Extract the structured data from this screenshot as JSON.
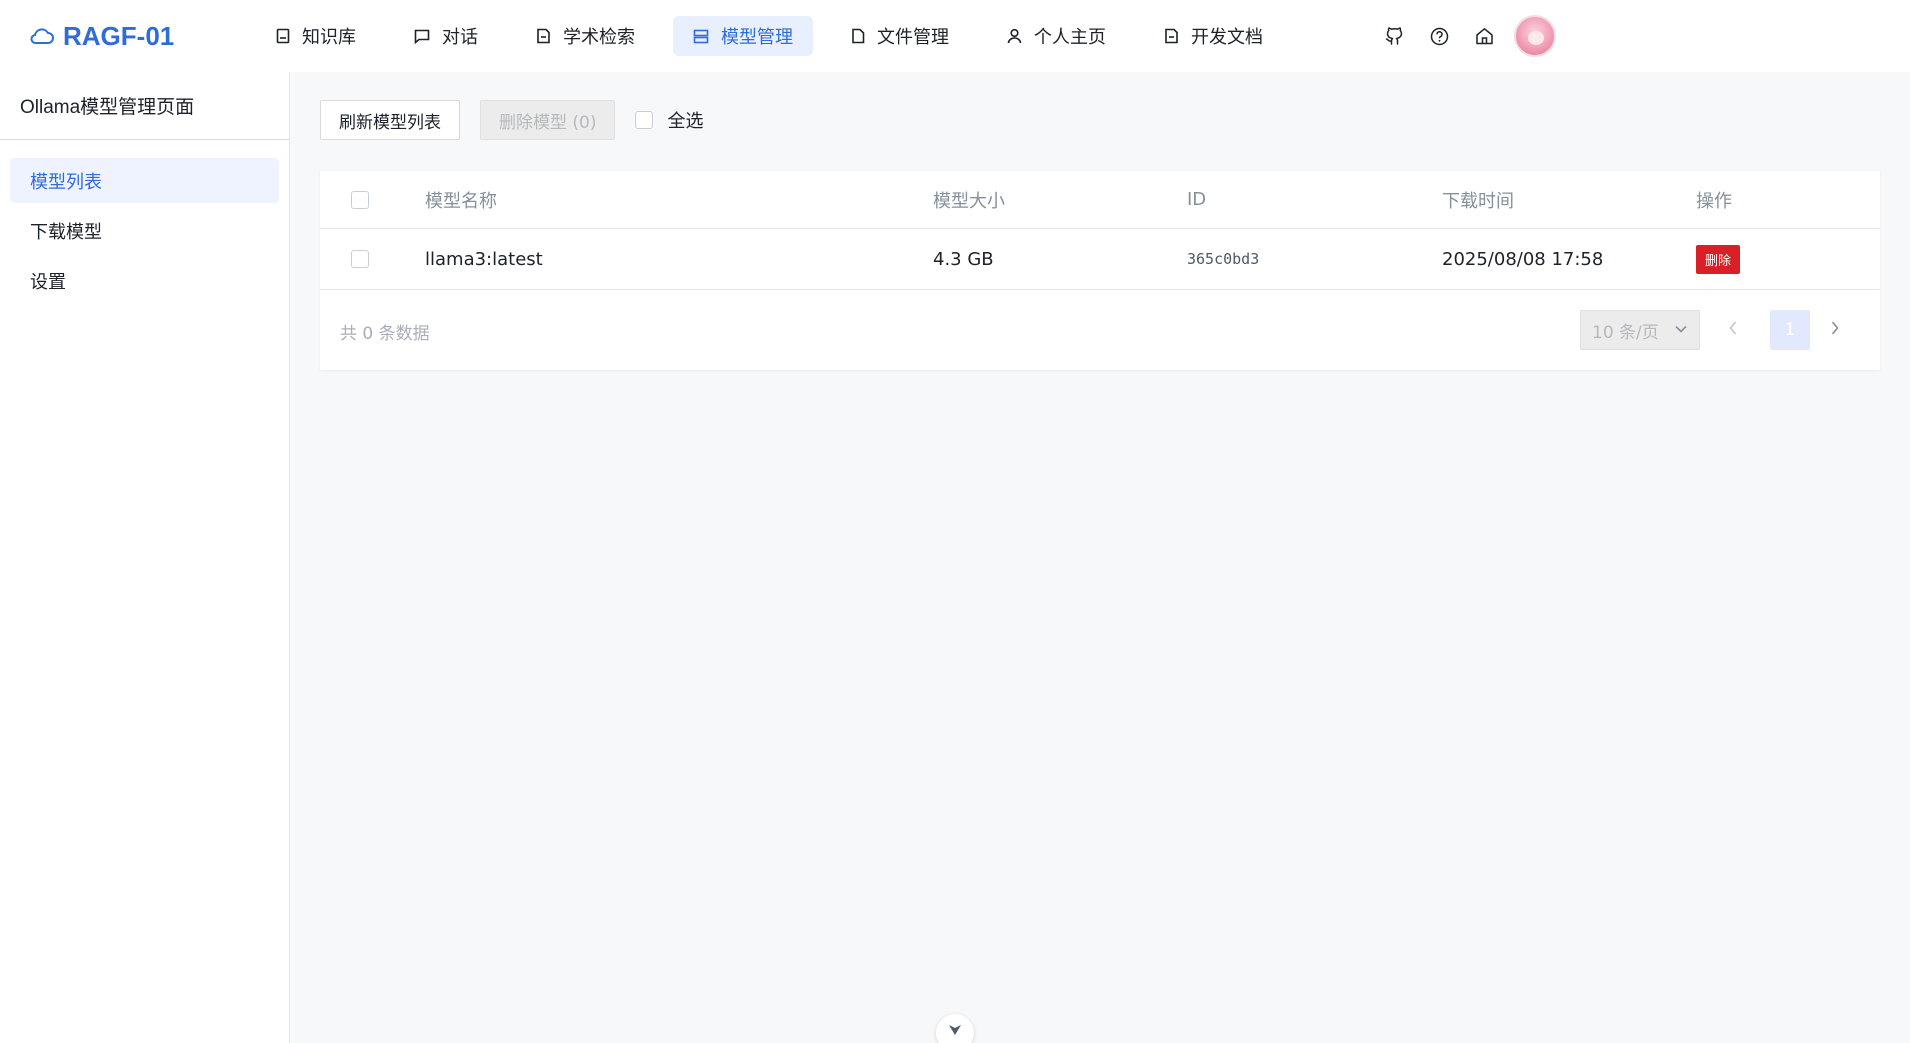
{
  "app": {
    "logo_text": "RAGF-01",
    "logo_icon": "cloud-icon"
  },
  "nav": {
    "items": [
      {
        "label": "知识库",
        "icon": "book-icon"
      },
      {
        "label": "对话",
        "icon": "chat-icon"
      },
      {
        "label": "学术检索",
        "icon": "doc-search-icon"
      },
      {
        "label": "模型管理",
        "icon": "server-icon",
        "active": true
      },
      {
        "label": "文件管理",
        "icon": "file-icon"
      },
      {
        "label": "个人主页",
        "icon": "user-icon"
      },
      {
        "label": "开发文档",
        "icon": "doc-edit-icon"
      }
    ],
    "right_icons": [
      "github-icon",
      "help-icon",
      "home-icon"
    ]
  },
  "sidebar": {
    "title": "Ollama模型管理页面",
    "items": [
      {
        "label": "模型列表",
        "active": true
      },
      {
        "label": "下载模型"
      },
      {
        "label": "设置"
      }
    ]
  },
  "toolbar": {
    "refresh_label": "刷新模型列表",
    "delete_label": "删除模型 (0)",
    "select_all_label": "全选"
  },
  "table": {
    "headers": {
      "name": "模型名称",
      "size": "模型大小",
      "id": "ID",
      "time": "下载时间",
      "op": "操作"
    },
    "rows": [
      {
        "name": "llama3:latest",
        "size": "4.3 GB",
        "id": "365c0bd3",
        "time": "2025/08/08 17:58",
        "op": "删除"
      }
    ]
  },
  "footer": {
    "total_text": "共 0 条数据",
    "page_size": "10 条/页",
    "current_page": "1"
  },
  "colors": {
    "accent": "#2f6bd9",
    "danger": "#d92027",
    "active_bg": "#e8f0ff"
  }
}
